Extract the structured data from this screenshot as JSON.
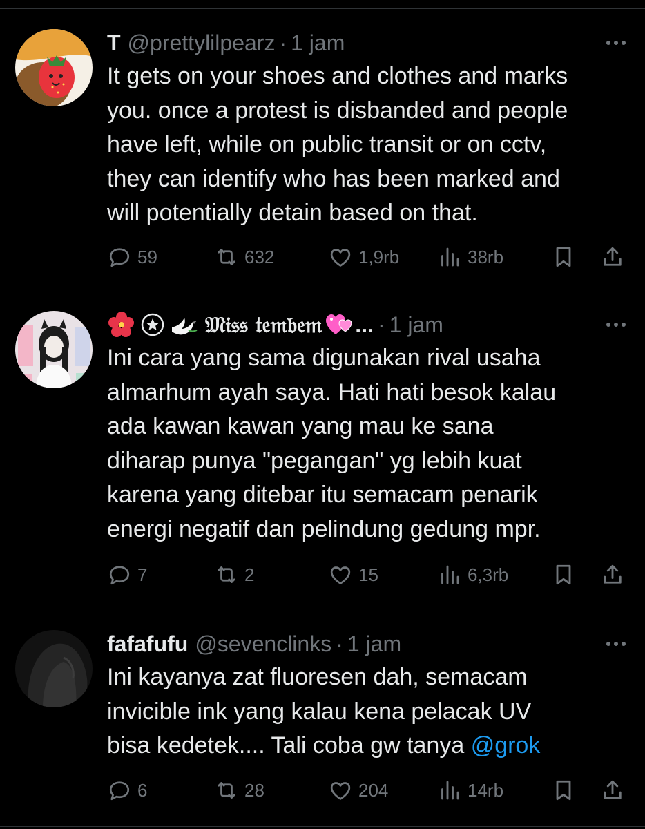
{
  "tweets": [
    {
      "name": "T",
      "handle": "@prettylilpearz",
      "separator": "·",
      "time": "1 jam",
      "text_lines": [
        "It gets on your shoes and clothes and marks",
        "you. once a protest is disbanded and people",
        "have left, while on public transit or on cctv,",
        "they can identify who has been marked and",
        "will potentially detain based on that."
      ],
      "replies": "59",
      "reposts": "632",
      "likes": "1,9rb",
      "views": "38rb"
    },
    {
      "name": "𝔐𝔦𝔰𝔰 𝔱𝔢𝔪𝔟𝔢𝔪",
      "name_suffix": " ...",
      "separator": "·",
      "time": "1 jam",
      "text_lines": [
        "Ini cara yang sama digunakan rival usaha",
        "almarhum ayah saya. Hati hati besok kalau",
        "ada kawan kawan yang mau ke sana",
        "diharap punya \"pegangan\" yg lebih kuat",
        "karena yang ditebar itu semacam penarik",
        "energi negatif dan pelindung gedung mpr."
      ],
      "replies": "7",
      "reposts": "2",
      "likes": "15",
      "views": "6,3rb"
    },
    {
      "name": "fafafufu",
      "handle": "@sevenclinks",
      "separator": "·",
      "time": "1 jam",
      "text_lines": [
        "Ini kayanya zat fluoresen dah, semacam",
        "invicible ink yang kalau kena pelacak UV"
      ],
      "text_last_prefix": "bisa kedetek.... Tali coba gw tanya ",
      "mention": "@grok",
      "replies": "6",
      "reposts": "28",
      "likes": "204",
      "views": "14rb"
    }
  ],
  "colors": {
    "text": "#e7e9ea",
    "secondary": "#71767b",
    "link": "#1d9bf0",
    "divider": "#2f3336"
  },
  "icons": [
    "reply-icon",
    "repost-icon",
    "like-icon",
    "views-icon",
    "bookmark-icon",
    "share-icon",
    "more-icon"
  ]
}
